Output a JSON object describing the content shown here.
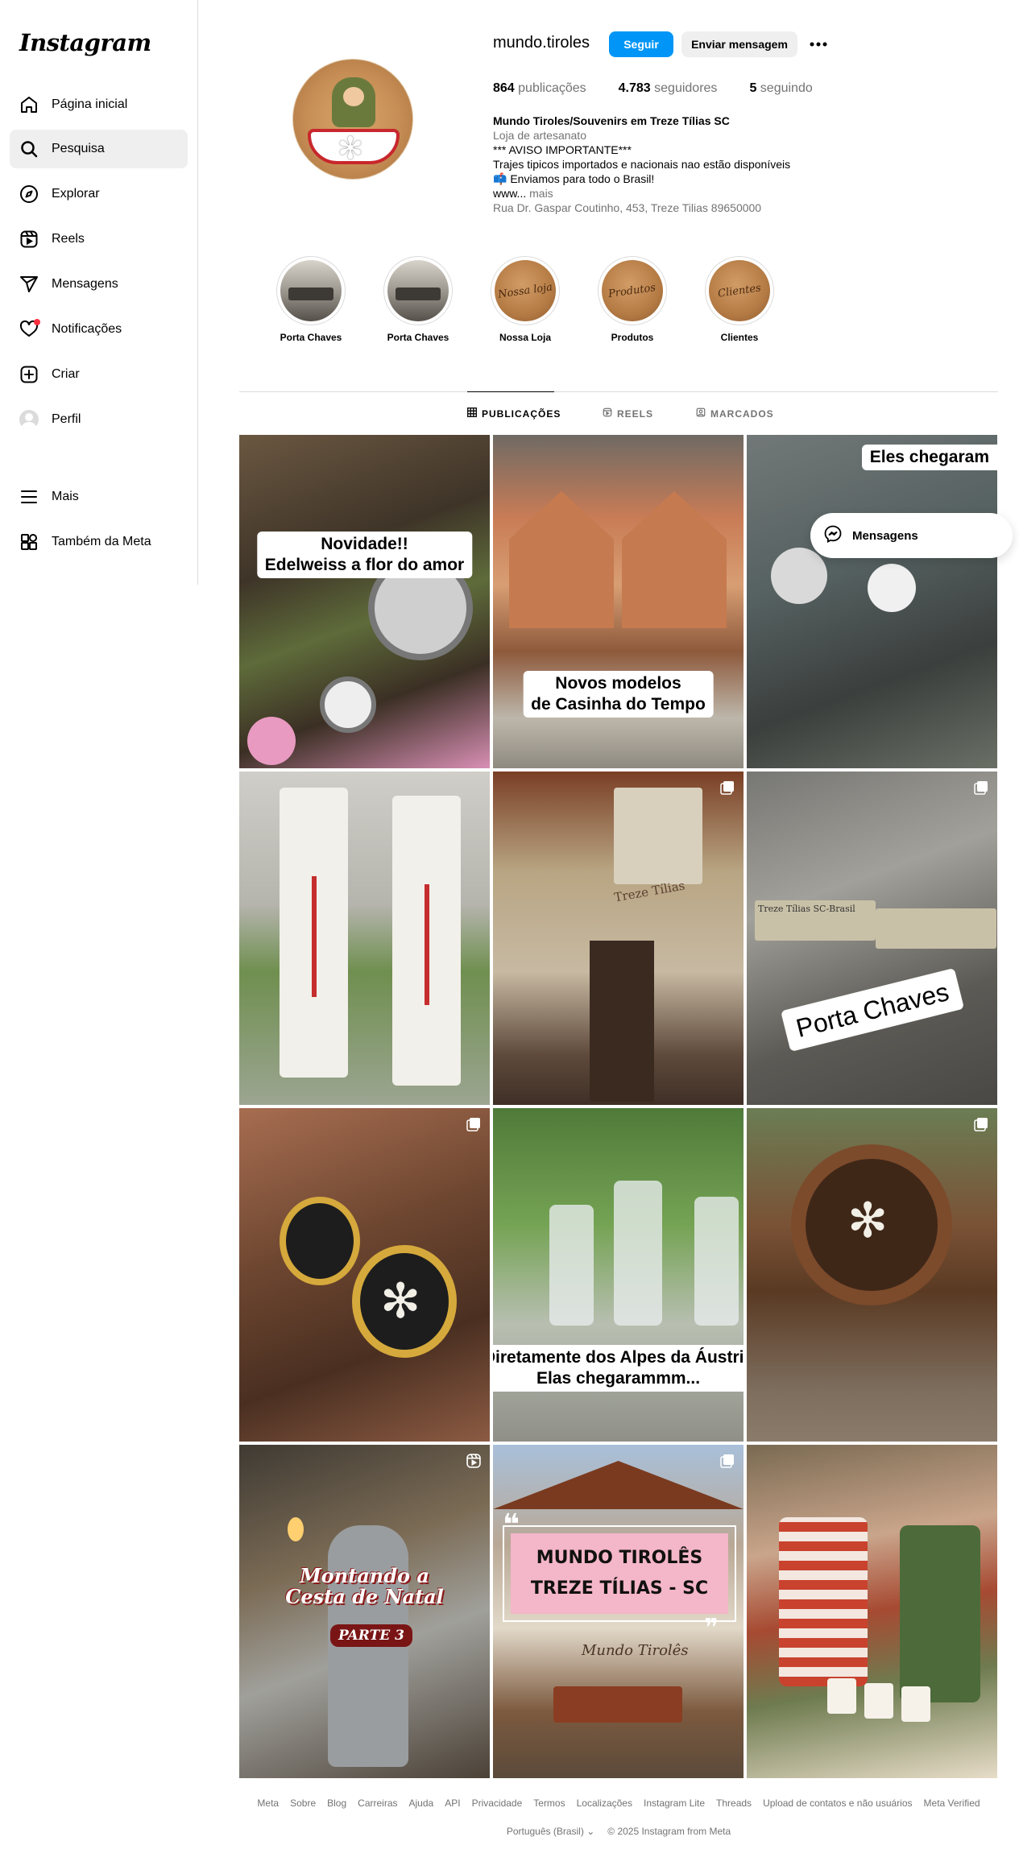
{
  "app": {
    "logo": "Instagram"
  },
  "sidebar": {
    "items": [
      {
        "label": "Página inicial",
        "icon": "home-icon"
      },
      {
        "label": "Pesquisa",
        "icon": "search-icon",
        "active": true
      },
      {
        "label": "Explorar",
        "icon": "compass-icon"
      },
      {
        "label": "Reels",
        "icon": "reels-icon"
      },
      {
        "label": "Mensagens",
        "icon": "send-icon"
      },
      {
        "label": "Notificações",
        "icon": "heart-icon"
      },
      {
        "label": "Criar",
        "icon": "plus-square-icon"
      },
      {
        "label": "Perfil",
        "icon": "avatar-icon"
      }
    ],
    "more": "Mais",
    "meta": "Também da Meta"
  },
  "profile": {
    "username": "mundo.tiroles",
    "follow_label": "Seguir",
    "message_label": "Enviar mensagem",
    "stats": {
      "posts_count": "864",
      "posts_label": "publicações",
      "followers_count": "4.783",
      "followers_label": "seguidores",
      "following_count": "5",
      "following_label": "seguindo"
    },
    "bio": {
      "name": "Mundo Tiroles/Souvenirs em Treze Tílias SC",
      "category": "Loja de artesanato",
      "line1": "*** AVISO IMPORTANTE***",
      "line2": "Trajes tipicos importados e nacionais nao estão disponíveis",
      "line3": "📫 Enviamos para todo o Brasil!",
      "line4": "www...",
      "more": "mais",
      "address": "Rua Dr. Gaspar Coutinho, 453, Treze Tilias 89650000"
    }
  },
  "highlights": [
    {
      "label": "Porta Chaves",
      "cover_text": ""
    },
    {
      "label": "Porta Chaves",
      "cover_text": ""
    },
    {
      "label": "Nossa Loja",
      "cover_text": "Nossa loja"
    },
    {
      "label": "Produtos",
      "cover_text": "Produtos"
    },
    {
      "label": "Clientes",
      "cover_text": "Clientes"
    }
  ],
  "tabs": [
    {
      "label": "PUBLICAÇÕES",
      "active": true
    },
    {
      "label": "REELS",
      "active": false
    },
    {
      "label": "MARCADOS",
      "active": false
    }
  ],
  "posts": [
    {
      "caption1": "Novidade!!",
      "caption2": "Edelweiss  a flor do amor"
    },
    {
      "caption1": "Novos modelos",
      "caption2": "de Casinha do Tempo"
    },
    {
      "caption1": "Eles chegaram"
    },
    {},
    {
      "sign": "Treze Tílias"
    },
    {
      "caption1": "Porta Chaves",
      "plaque": "Treze Tílias SC-Brasil"
    },
    {},
    {
      "caption1": "Diretamente dos Alpes da Áustria",
      "caption2": "Elas chegarammm..."
    },
    {},
    {
      "caption1": "Montando a",
      "caption2": "Cesta de Natal",
      "caption3": "PARTE 3"
    },
    {
      "caption1": "MUNDO TIROLÊS",
      "caption2": "TREZE TÍLIAS - SC",
      "sign": "Mundo Tirolês"
    },
    {}
  ],
  "floating_messages": {
    "label": "Mensagens"
  },
  "footer": {
    "links": [
      "Meta",
      "Sobre",
      "Blog",
      "Carreiras",
      "Ajuda",
      "API",
      "Privacidade",
      "Termos",
      "Localizações",
      "Instagram Lite",
      "Threads",
      "Upload de contatos e não usuários",
      "Meta Verified"
    ],
    "language": "Português (Brasil)",
    "copyright": "© 2025 Instagram from Meta"
  },
  "colors": {
    "accent": "#0095f6",
    "notification": "#ff3040",
    "muted": "#737373"
  }
}
